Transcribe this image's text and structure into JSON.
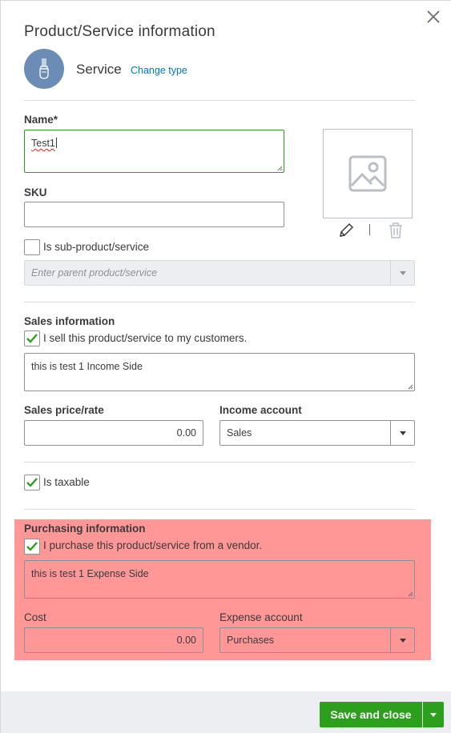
{
  "header": {
    "title": "Product/Service information",
    "type_label": "Service",
    "change_type_link": "Change type"
  },
  "basic": {
    "name_label": "Name*",
    "name_value": "Test1",
    "sku_label": "SKU",
    "sku_value": "",
    "sub_product_label": "Is sub-product/service",
    "sub_product_checked": false,
    "parent_placeholder": "Enter parent product/service"
  },
  "sales": {
    "section_label": "Sales information",
    "sell_checkbox_label": "I sell this product/service to my customers.",
    "sell_checked": true,
    "description": "this is test 1 Income Side",
    "price_label": "Sales price/rate",
    "price_value": "0.00",
    "income_account_label": "Income account",
    "income_account_value": "Sales"
  },
  "tax": {
    "taxable_label": "Is taxable",
    "taxable_checked": true
  },
  "purchasing": {
    "section_label": "Purchasing information",
    "purchase_checkbox_label": "I purchase this product/service from a vendor.",
    "purchase_checked": true,
    "description": "this is test 1 Expense Side",
    "cost_label": "Cost",
    "cost_value": "0.00",
    "expense_account_label": "Expense account",
    "expense_account_value": "Purchases",
    "highlight_color": "#ff9797"
  },
  "footer": {
    "save_button_label": "Save and close"
  },
  "icons": {
    "close": "close-icon",
    "type": "paintbrush-icon",
    "image_placeholder": "image-placeholder-icon",
    "edit": "pencil-icon",
    "delete": "trash-icon"
  },
  "colors": {
    "accent_green": "#2ca01c",
    "link_blue": "#0077c5",
    "type_icon_bg": "#6b8db5"
  }
}
